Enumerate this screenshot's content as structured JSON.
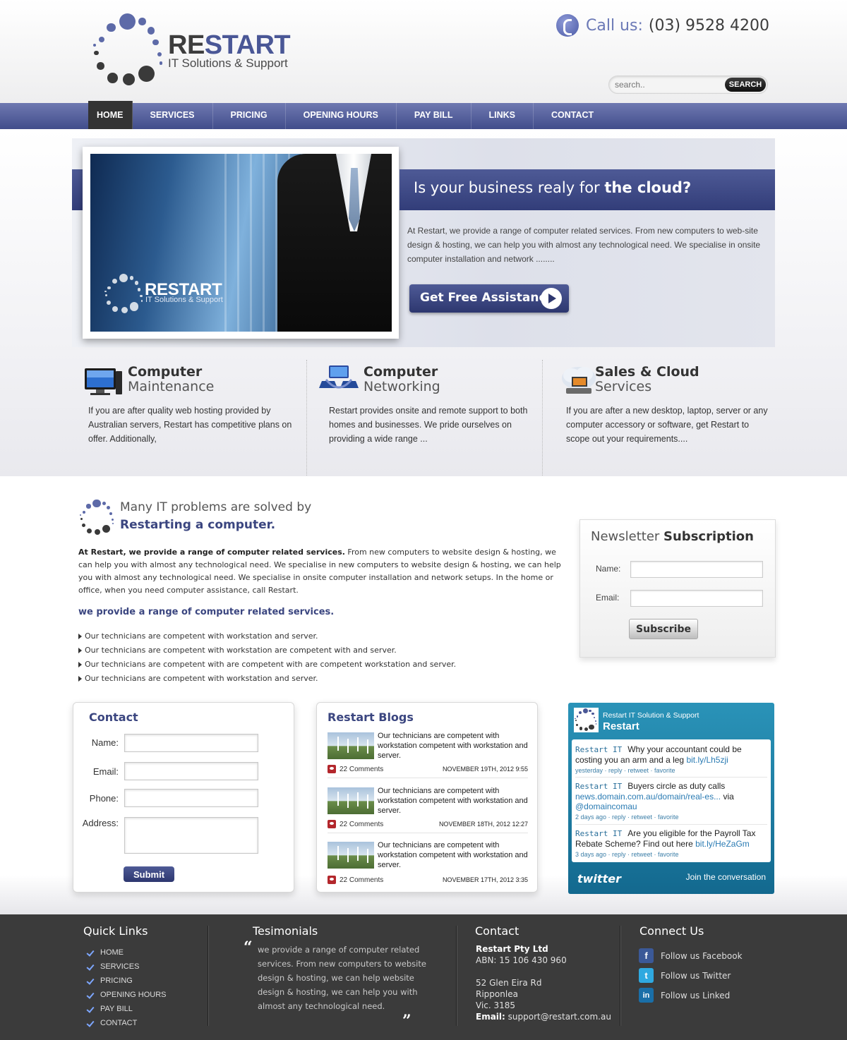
{
  "brand": {
    "name_part1": "RE",
    "name_part2": "START",
    "tagline": "IT Solutions & Support"
  },
  "call": {
    "label": "Call us:",
    "number": "(03) 9528 4200"
  },
  "search": {
    "placeholder": "search..",
    "button": "SEARCH"
  },
  "nav": {
    "items": [
      "HOME",
      "SERVICES",
      "PRICING",
      "OPENING HOURS",
      "PAY BILL",
      "LINKS",
      "CONTACT"
    ],
    "active": "HOME"
  },
  "banner": {
    "headline_part1": "Is your business realy for ",
    "headline_part2": "the cloud?",
    "text": "At Restart, we provide a range of computer related services. From new computers to web-site design & hosting, we can help you with almost any technological need. We specialise in onsite computer installation and network ........",
    "cta": "Get Free Assistance",
    "photo_logo_name": "RESTART",
    "photo_logo_tag": "IT Solutions & Support"
  },
  "services": [
    {
      "title1": "Computer",
      "title2": "Maintenance",
      "icon": "monitor-icon",
      "text": "If you are after quality web hosting provided by Australian servers, Restart has competitive plans on offer. Additionally,"
    },
    {
      "title1": "Computer",
      "title2": "Networking",
      "icon": "network-icon",
      "text": "Restart provides onsite and remote support to both homes and businesses. We pride ourselves on providing a wide range ..."
    },
    {
      "title1": "Sales & Cloud",
      "title2": "Services",
      "icon": "cloud-icon",
      "text": "If you are after a new desktop, laptop, server or any computer accessory or software, get Restart to scope out your requirements...."
    }
  ],
  "intro": {
    "heading1": "Many IT problems are solved by",
    "heading2": "Restarting a computer.",
    "text_bold": "At Restart, we provide a range of computer related services.",
    "text_rest": " From new computers to website design & hosting, we can help you with almost any technological need. We specialise in new computers to website design & hosting, we can help you with almost any technological need. We specialise in onsite computer installation and network setups. In the home or office, when you need computer assistance, call Restart.",
    "subheading": "we provide a range of computer related services.",
    "bullets": [
      "Our technicians are competent with workstation and server.",
      "Our technicians are competent with workstation are competent with and server.",
      "Our technicians are competent with are competent with  are competent workstation and server.",
      "Our technicians are competent with workstation and server."
    ]
  },
  "newsletter": {
    "title_light": "Newsletter ",
    "title_bold": "Subscription",
    "name_label": "Name:",
    "email_label": "Email:",
    "button": "Subscribe"
  },
  "contact_form": {
    "title": "Contact",
    "name_label": "Name:",
    "email_label": "Email:",
    "phone_label": "Phone:",
    "address_label": "Address:",
    "button": "Submit"
  },
  "blogs": {
    "title": "Restart Blogs",
    "items": [
      {
        "text": "Our technicians are  competent with workstation competent with workstation and server.",
        "comments": "22 Comments",
        "date": "NOVEMBER 19TH, 2012 9:55"
      },
      {
        "text": "Our technicians are  competent with workstation competent with workstation and server.",
        "comments": "22 Comments",
        "date": "NOVEMBER 18TH, 2012 12:27"
      },
      {
        "text": "Our technicians are  competent with workstation competent with workstation and server.",
        "comments": "22 Comments",
        "date": "NOVEMBER 17TH, 2012 3:35"
      }
    ]
  },
  "twitter": {
    "account_sub": "Restart IT Solution & Support",
    "account_name": "Restart",
    "tweets": [
      {
        "who": "Restart IT",
        "text": "Why your accountant could be costing you an arm and a leg ",
        "link": "bit.ly/Lh5zji",
        "link2": "",
        "after": "",
        "meta": "yesterday · reply · retweet · favorite"
      },
      {
        "who": "Restart IT",
        "text": "Buyers circle as duty calls ",
        "link": "news.domain.com.au/domain/real-es...",
        "after": " via ",
        "link2": "@domaincomau",
        "meta": "2 days ago · reply · retweet · favorite"
      },
      {
        "who": "Restart IT",
        "text": "Are you eligible for the Payroll Tax Rebate Scheme? Find out here ",
        "link": "bit.ly/HeZaGm",
        "link2": "",
        "after": "",
        "meta": "3 days ago · reply · retweet · favorite"
      }
    ],
    "brand": "twitter",
    "join": "Join the conversation"
  },
  "footer": {
    "quick_links_title": "Quick Links",
    "quick_links": [
      "HOME",
      "SERVICES",
      "PRICING",
      "OPENING HOURS",
      "PAY BILL",
      "CONTACT"
    ],
    "testimonials_title": "Tesimonials",
    "testimonial": "we provide a range of computer related services. From new computers to website design & hosting, we can help website design & hosting, we can help you with almost any technological need.",
    "contact_title": "Contact",
    "company": "Restart Pty Ltd",
    "abn": "ABN: 15 106 430 960",
    "address1": "52 Glen Eira Rd",
    "address2": "Ripponlea",
    "address3": "Vic. 3185",
    "email_label": "Email:",
    "email": " support@restart.com.au",
    "connect_title": "Connect Us",
    "social": [
      {
        "label": "Follow us Facebook",
        "icon": "facebook-icon",
        "glyph": "f",
        "color": "#3b5998"
      },
      {
        "label": "Follow us Twitter",
        "icon": "twitter-icon",
        "glyph": "t",
        "color": "#2fa9e0"
      },
      {
        "label": "Follow us Linked",
        "icon": "linkedin-icon",
        "glyph": "in",
        "color": "#1a6fa8"
      }
    ]
  },
  "colors": {
    "brand_blue": "#4a5796",
    "nav": "#5a65a0",
    "footer": "#3b3b3b",
    "twitter": "#1f82a8"
  }
}
